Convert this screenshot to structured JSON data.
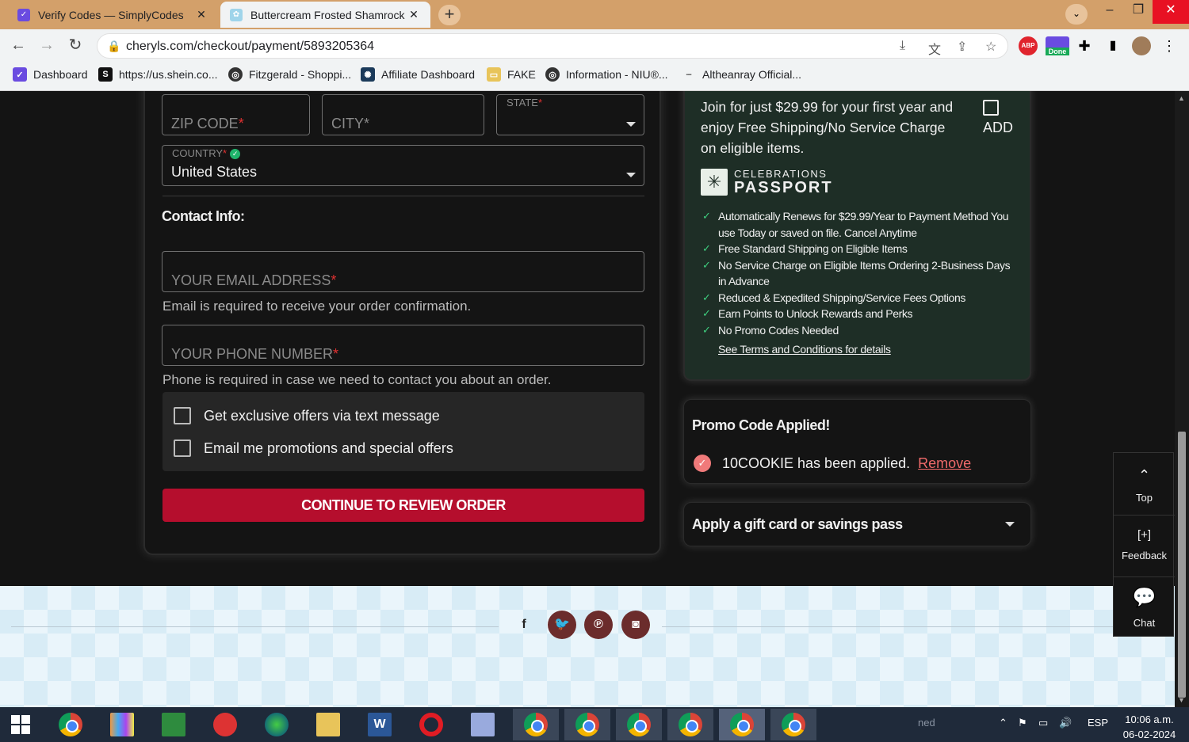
{
  "browser": {
    "tabs": [
      {
        "title": "Verify Codes — SimplyCodes",
        "active": false
      },
      {
        "title": "Buttercream Frosted Shamrock C",
        "active": true
      }
    ],
    "url": "cheryls.com/checkout/payment/5893205364",
    "bookmarks": [
      "Dashboard",
      "https://us.shein.co...",
      "Fitzgerald - Shoppi...",
      "Affiliate Dashboard",
      "FAKE",
      "Information - NIU®...",
      "Altheanray Official..."
    ],
    "extension_badges": {
      "abp": "ABP",
      "done": "Done"
    }
  },
  "form": {
    "zip_placeholder": "ZIP CODE",
    "city_placeholder": "CITY",
    "state_label": "STATE",
    "country_label": "COUNTRY",
    "country_value": "United States",
    "contact_heading": "Contact Info:",
    "email_placeholder": "YOUR EMAIL ADDRESS",
    "email_help": "Email is required to receive your order confirmation.",
    "phone_placeholder": "YOUR PHONE NUMBER",
    "phone_help": "Phone is required in case we need to contact you about an order.",
    "required_mark": "*",
    "opt_text": "Get exclusive offers via text message",
    "opt_email": "Email me promotions and special offers",
    "continue_label": "CONTINUE TO REVIEW ORDER"
  },
  "passport": {
    "join_text": "Join for just $29.99 for your first year and enjoy Free Shipping/No Service Charge on eligible items.",
    "add_label": "ADD",
    "logo_line1": "CELEBRATIONS",
    "logo_line2": "PASSPORT",
    "benefits": [
      "Automatically Renews for $29.99/Year to Payment Method You use Today or saved on file. Cancel Anytime",
      "Free Standard Shipping on Eligible Items",
      "No Service Charge on Eligible Items Ordering 2-Business Days in Advance",
      "Reduced & Expedited Shipping/Service Fees Options",
      "Earn Points to Unlock Rewards and Perks",
      "No Promo Codes Needed"
    ],
    "terms_link": "See Terms and Conditions for details"
  },
  "promo": {
    "title": "Promo Code Applied!",
    "message": "10COOKIE has been applied.",
    "remove_label": "Remove"
  },
  "gift": {
    "title": "Apply a gift card or savings pass"
  },
  "footer": {
    "social": [
      "f",
      "twitter",
      "pinterest",
      "instagram"
    ]
  },
  "side_widget": {
    "top_label": "Top",
    "feedback_label": "Feedback",
    "feedback_icon": "[+]",
    "chat_label": "Chat"
  },
  "taskbar": {
    "tray_text": "ned",
    "language": "ESP",
    "time": "10:06 a.m.",
    "date": "06-02-2024"
  }
}
